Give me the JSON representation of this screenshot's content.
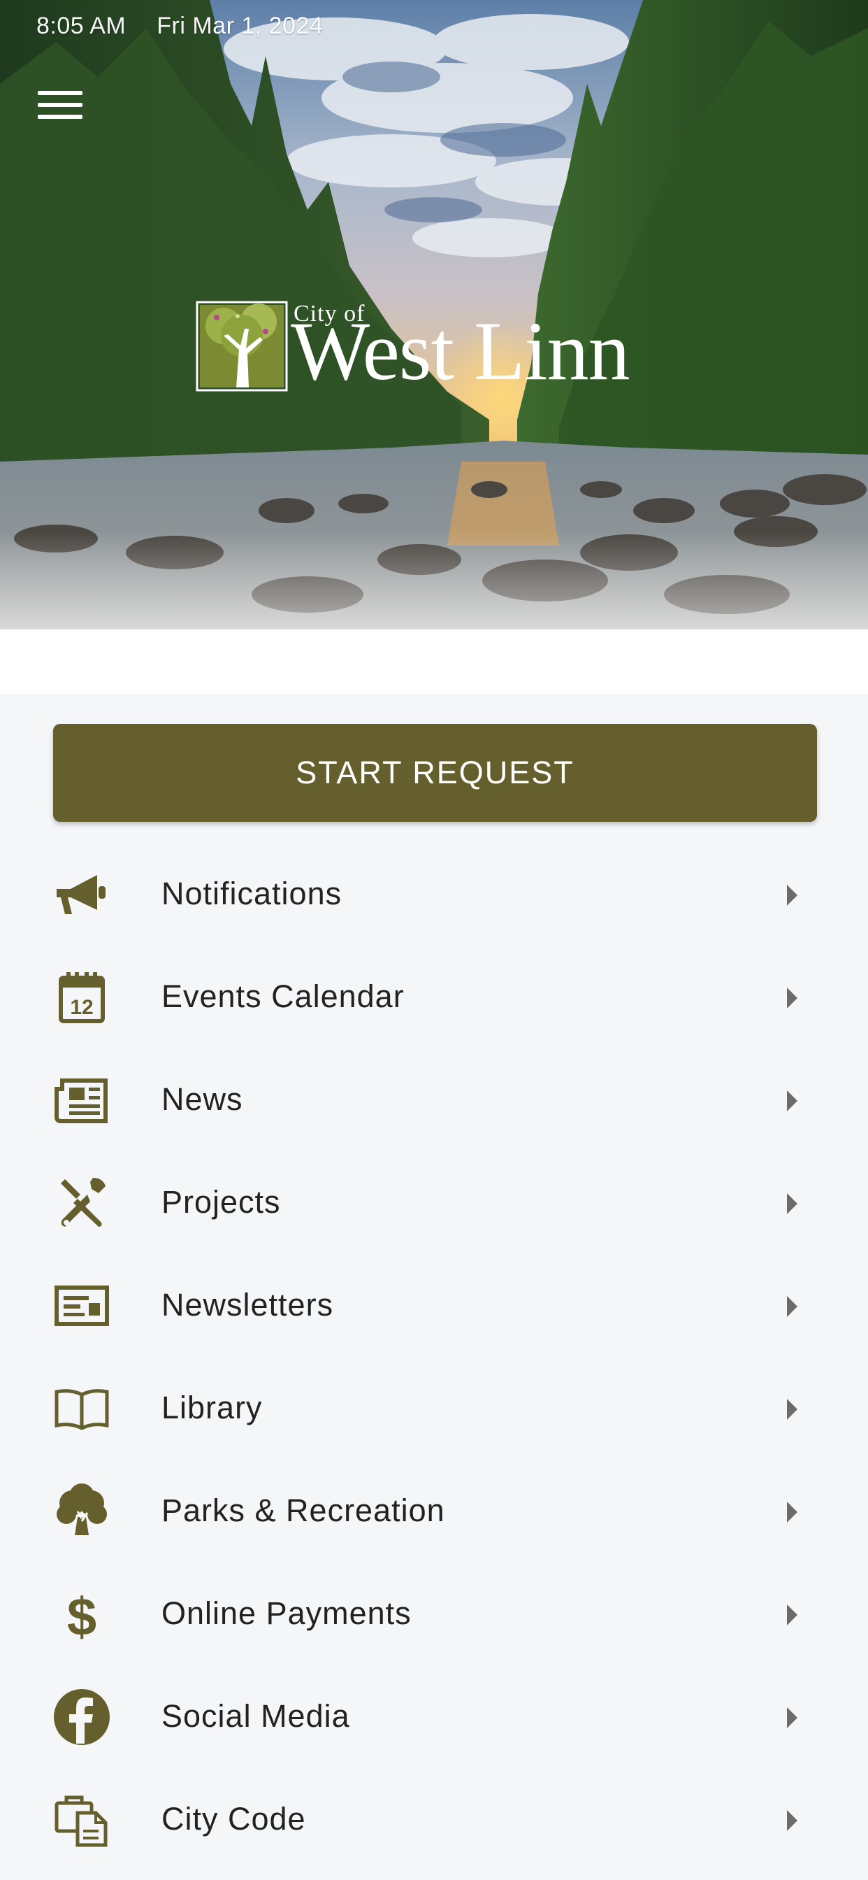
{
  "status_bar": {
    "time": "8:05 AM",
    "date": "Fri Mar 1, 2024"
  },
  "header": {
    "logo_small": "City of",
    "logo_big": "West Linn",
    "menu_icon": "hamburger-menu-icon"
  },
  "primary_action": {
    "label": "START REQUEST"
  },
  "colors": {
    "accent": "#645f2d",
    "background": "#f4f6f8",
    "text": "#222222"
  },
  "menu": [
    {
      "label": "Notifications",
      "icon": "megaphone-icon"
    },
    {
      "label": "Events Calendar",
      "icon": "calendar-icon"
    },
    {
      "label": "News",
      "icon": "newspaper-icon"
    },
    {
      "label": "Projects",
      "icon": "tools-icon"
    },
    {
      "label": "Newsletters",
      "icon": "newsletter-icon"
    },
    {
      "label": "Library",
      "icon": "book-icon"
    },
    {
      "label": "Parks & Recreation",
      "icon": "tree-icon"
    },
    {
      "label": "Online Payments",
      "icon": "dollar-icon"
    },
    {
      "label": "Social Media",
      "icon": "facebook-icon"
    },
    {
      "label": "City Code",
      "icon": "briefcase-document-icon"
    }
  ]
}
